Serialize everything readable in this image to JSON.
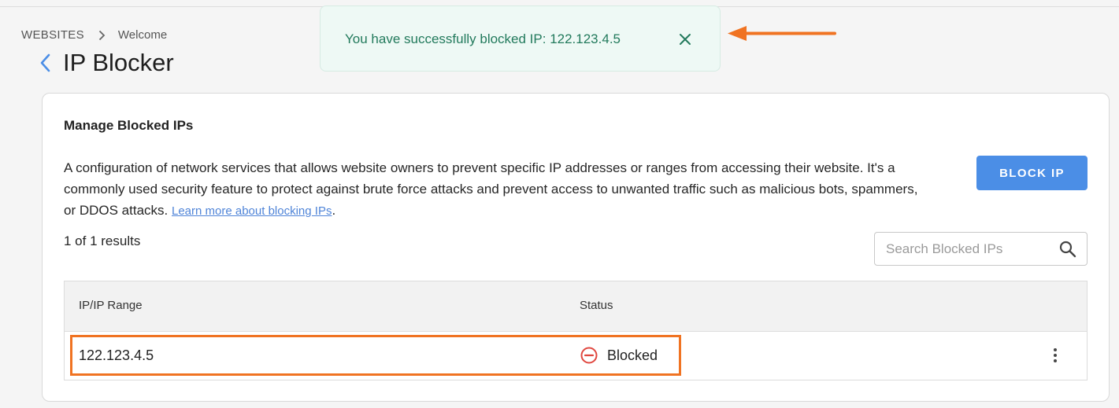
{
  "breadcrumb": {
    "root": "WEBSITES",
    "current": "Welcome"
  },
  "page": {
    "title": "IP Blocker"
  },
  "toast": {
    "message": "You have successfully blocked IP: 122.123.4.5"
  },
  "card": {
    "heading": "Manage Blocked IPs",
    "description": "A configuration of network services that allows website owners to prevent specific IP addresses or ranges from accessing their website. It's a commonly used security feature to protect against brute force attacks and prevent access to unwanted traffic such as malicious bots, spammers, or DDOS attacks.",
    "learn_more": "Learn more about blocking IPs",
    "period": ".",
    "block_button": "BLOCK IP",
    "results": "1 of 1 results"
  },
  "search": {
    "placeholder": "Search Blocked IPs",
    "value": ""
  },
  "table": {
    "columns": [
      "IP/IP Range",
      "Status"
    ],
    "rows": [
      {
        "ip": "122.123.4.5",
        "status": "Blocked"
      }
    ]
  },
  "colors": {
    "accent": "#4b8ee6",
    "toast_bg": "#eef9f5",
    "toast_text": "#227a5c",
    "blocked_status": "#e0473f",
    "annotation": "#f07322"
  },
  "icons": {
    "breadcrumb_separator": "chevron-right-icon",
    "back": "chevron-left-icon",
    "toast_close": "close-icon",
    "search": "search-icon",
    "status": "minus-circle-icon",
    "row_menu": "more-vertical-icon"
  }
}
